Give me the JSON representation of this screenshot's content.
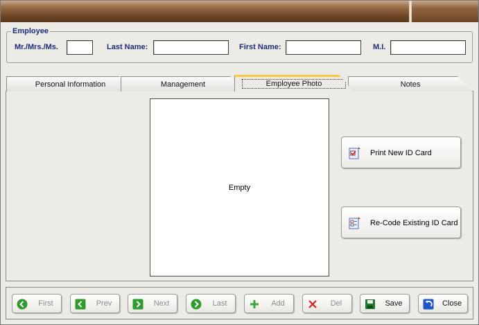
{
  "employee_group": {
    "title": "Employee",
    "fields": [
      {
        "label": "Mr./Mrs./Ms.",
        "value": ""
      },
      {
        "label": "Last Name:",
        "value": ""
      },
      {
        "label": "First Name:",
        "value": ""
      },
      {
        "label": "M.I.",
        "value": ""
      }
    ]
  },
  "tabs": [
    {
      "label": "Personal Information",
      "active": false
    },
    {
      "label": "Management",
      "active": false
    },
    {
      "label": "Employee Photo",
      "active": true
    },
    {
      "label": "Notes",
      "active": false
    }
  ],
  "photo": {
    "placeholder_text": "Empty"
  },
  "actions": {
    "print_id": "Print New ID Card",
    "recode_id": "Re-Code Existing ID Card"
  },
  "nav_buttons": [
    {
      "label": "First",
      "icon": "arrow-left-circle-icon",
      "enabled": false
    },
    {
      "label": "Prev",
      "icon": "arrow-left-square-icon",
      "enabled": false
    },
    {
      "label": "Next",
      "icon": "arrow-right-square-icon",
      "enabled": false
    },
    {
      "label": "Last",
      "icon": "arrow-right-circle-icon",
      "enabled": false
    },
    {
      "label": "Add",
      "icon": "plus-icon",
      "enabled": false
    },
    {
      "label": "Del",
      "icon": "delete-x-icon",
      "enabled": false
    },
    {
      "label": "Save",
      "icon": "save-disk-icon",
      "enabled": true
    },
    {
      "label": "Close",
      "icon": "close-undo-icon",
      "enabled": true
    }
  ],
  "colors": {
    "label_blue": "#1a2c7c",
    "active_tab_accent": "#f5cc3c",
    "banner_brown": "#6e4625",
    "nav_green": "#2e9b2e",
    "delete_red": "#d42020",
    "close_blue": "#1f56c9"
  }
}
